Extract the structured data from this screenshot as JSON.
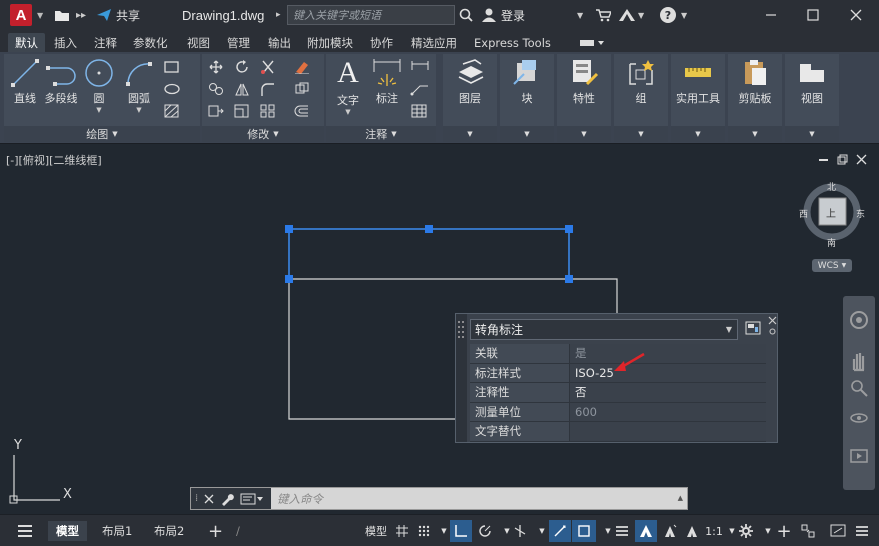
{
  "titlebar": {
    "app_logo": "A",
    "share_label": "共享",
    "doc_title": "Drawing1.dwg",
    "search_placeholder": "键入关键字或短语",
    "login_label": "登录",
    "help_label": "?"
  },
  "ribbon_tabs": [
    "默认",
    "插入",
    "注释",
    "参数化",
    "视图",
    "管理",
    "输出",
    "附加模块",
    "协作",
    "精选应用",
    "Express Tools"
  ],
  "ribbon": {
    "draw": {
      "title": "绘图",
      "tools": [
        "直线",
        "多段线",
        "圆",
        "圆弧"
      ]
    },
    "modify": {
      "title": "修改"
    },
    "annotation": {
      "title": "注释",
      "tools": [
        "文字",
        "标注"
      ]
    },
    "big_tools": [
      "图层",
      "块",
      "特性",
      "组",
      "实用工具",
      "剪贴板",
      "视图"
    ]
  },
  "viewport": {
    "view_label": "[-][俯视][二维线框]",
    "viewcube": {
      "north": "北",
      "south": "南",
      "east": "东",
      "west": "西",
      "face": "上",
      "wcs": "WCS"
    },
    "ucs": {
      "x": "X",
      "y": "Y"
    }
  },
  "properties": {
    "object_type": "转角标注",
    "rows": [
      {
        "key": "关联",
        "value": "是"
      },
      {
        "key": "标注样式",
        "value": "ISO-25"
      },
      {
        "key": "注释性",
        "value": "否"
      },
      {
        "key": "测量单位",
        "value": "600"
      },
      {
        "key": "文字替代",
        "value": ""
      }
    ]
  },
  "commandline": {
    "placeholder": "键入命令"
  },
  "statusbar": {
    "tabs": [
      "模型",
      "布局1",
      "布局2"
    ],
    "model_button": "模型",
    "scale": "1:1"
  },
  "colors": {
    "accent": "#2c5d8f",
    "arrow": "#e0252a",
    "selection": "#3c8cf0"
  }
}
